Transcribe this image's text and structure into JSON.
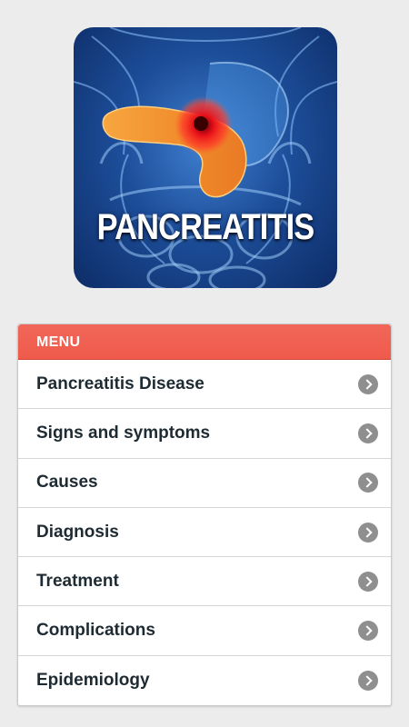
{
  "banner": {
    "title": "PANCREATITIS"
  },
  "menu": {
    "header": "MENU",
    "items": [
      {
        "label": "Pancreatitis Disease"
      },
      {
        "label": "Signs and symptoms"
      },
      {
        "label": "Causes"
      },
      {
        "label": "Diagnosis"
      },
      {
        "label": "Treatment"
      },
      {
        "label": "Complications"
      },
      {
        "label": "Epidemiology"
      }
    ]
  },
  "colors": {
    "header_accent": "#ef5a4b",
    "background": "#ececec",
    "chevron": "#8f8f8f"
  },
  "icons": {
    "item_chevron": "chevron-right-circle-icon"
  }
}
